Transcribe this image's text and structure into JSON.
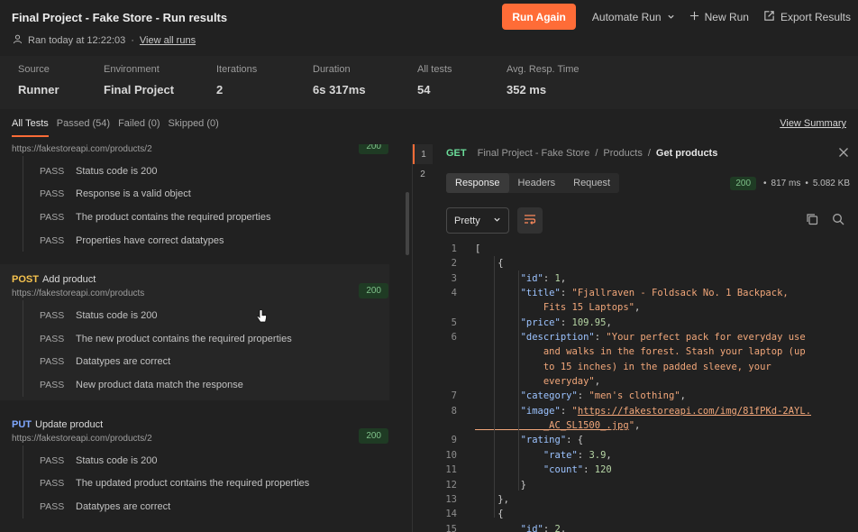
{
  "header": {
    "title": "Final Project - Fake Store - Run results",
    "run_time": "Ran today at 12:22:03",
    "separator": "·",
    "view_all_runs": "View all runs",
    "run_again": "Run Again",
    "automate_run": "Automate Run",
    "new_run": "New Run",
    "export_results": "Export Results"
  },
  "stats": [
    {
      "label": "Source",
      "value": "Runner"
    },
    {
      "label": "Environment",
      "value": "Final Project"
    },
    {
      "label": "Iterations",
      "value": "2"
    },
    {
      "label": "Duration",
      "value": "6s 317ms"
    },
    {
      "label": "All tests",
      "value": "54"
    },
    {
      "label": "Avg. Resp. Time",
      "value": "352 ms"
    }
  ],
  "filters": {
    "all": "All Tests",
    "passed": "Passed (54)",
    "failed": "Failed (0)",
    "skipped": "Skipped (0)",
    "view_summary": "View Summary"
  },
  "requests": [
    {
      "method": "",
      "name": "",
      "url": "https://fakestoreapi.com/products/2",
      "status": "200",
      "tests": [
        {
          "result": "PASS",
          "name": "Status code is 200"
        },
        {
          "result": "PASS",
          "name": "Response is a valid object"
        },
        {
          "result": "PASS",
          "name": "The product contains the required properties"
        },
        {
          "result": "PASS",
          "name": "Properties have correct datatypes"
        }
      ]
    },
    {
      "method": "POST",
      "name": "Add product",
      "url": "https://fakestoreapi.com/products",
      "status": "200",
      "tests": [
        {
          "result": "PASS",
          "name": "Status code is 200"
        },
        {
          "result": "PASS",
          "name": "The new product contains the required properties"
        },
        {
          "result": "PASS",
          "name": "Datatypes are correct"
        },
        {
          "result": "PASS",
          "name": "New product data match the response"
        }
      ]
    },
    {
      "method": "PUT",
      "name": "Update product",
      "url": "https://fakestoreapi.com/products/2",
      "status": "200",
      "tests": [
        {
          "result": "PASS",
          "name": "Status code is 200"
        },
        {
          "result": "PASS",
          "name": "The updated product contains the required properties"
        },
        {
          "result": "PASS",
          "name": "Datatypes are correct"
        }
      ]
    }
  ],
  "iterations_gutter": [
    "1",
    "2"
  ],
  "detail": {
    "method": "GET",
    "breadcrumb": [
      "Final Project - Fake Store",
      "Products"
    ],
    "current": "Get products",
    "tabs": [
      "Response",
      "Headers",
      "Request"
    ],
    "status": "200",
    "time": "817 ms",
    "size": "5.082 KB",
    "format": "Pretty"
  },
  "colors": {
    "accent": "#ff6c37",
    "get": "#6bdd9a",
    "post": "#f5c24e",
    "put": "#7fa8ff",
    "success": "#7fc18a"
  }
}
